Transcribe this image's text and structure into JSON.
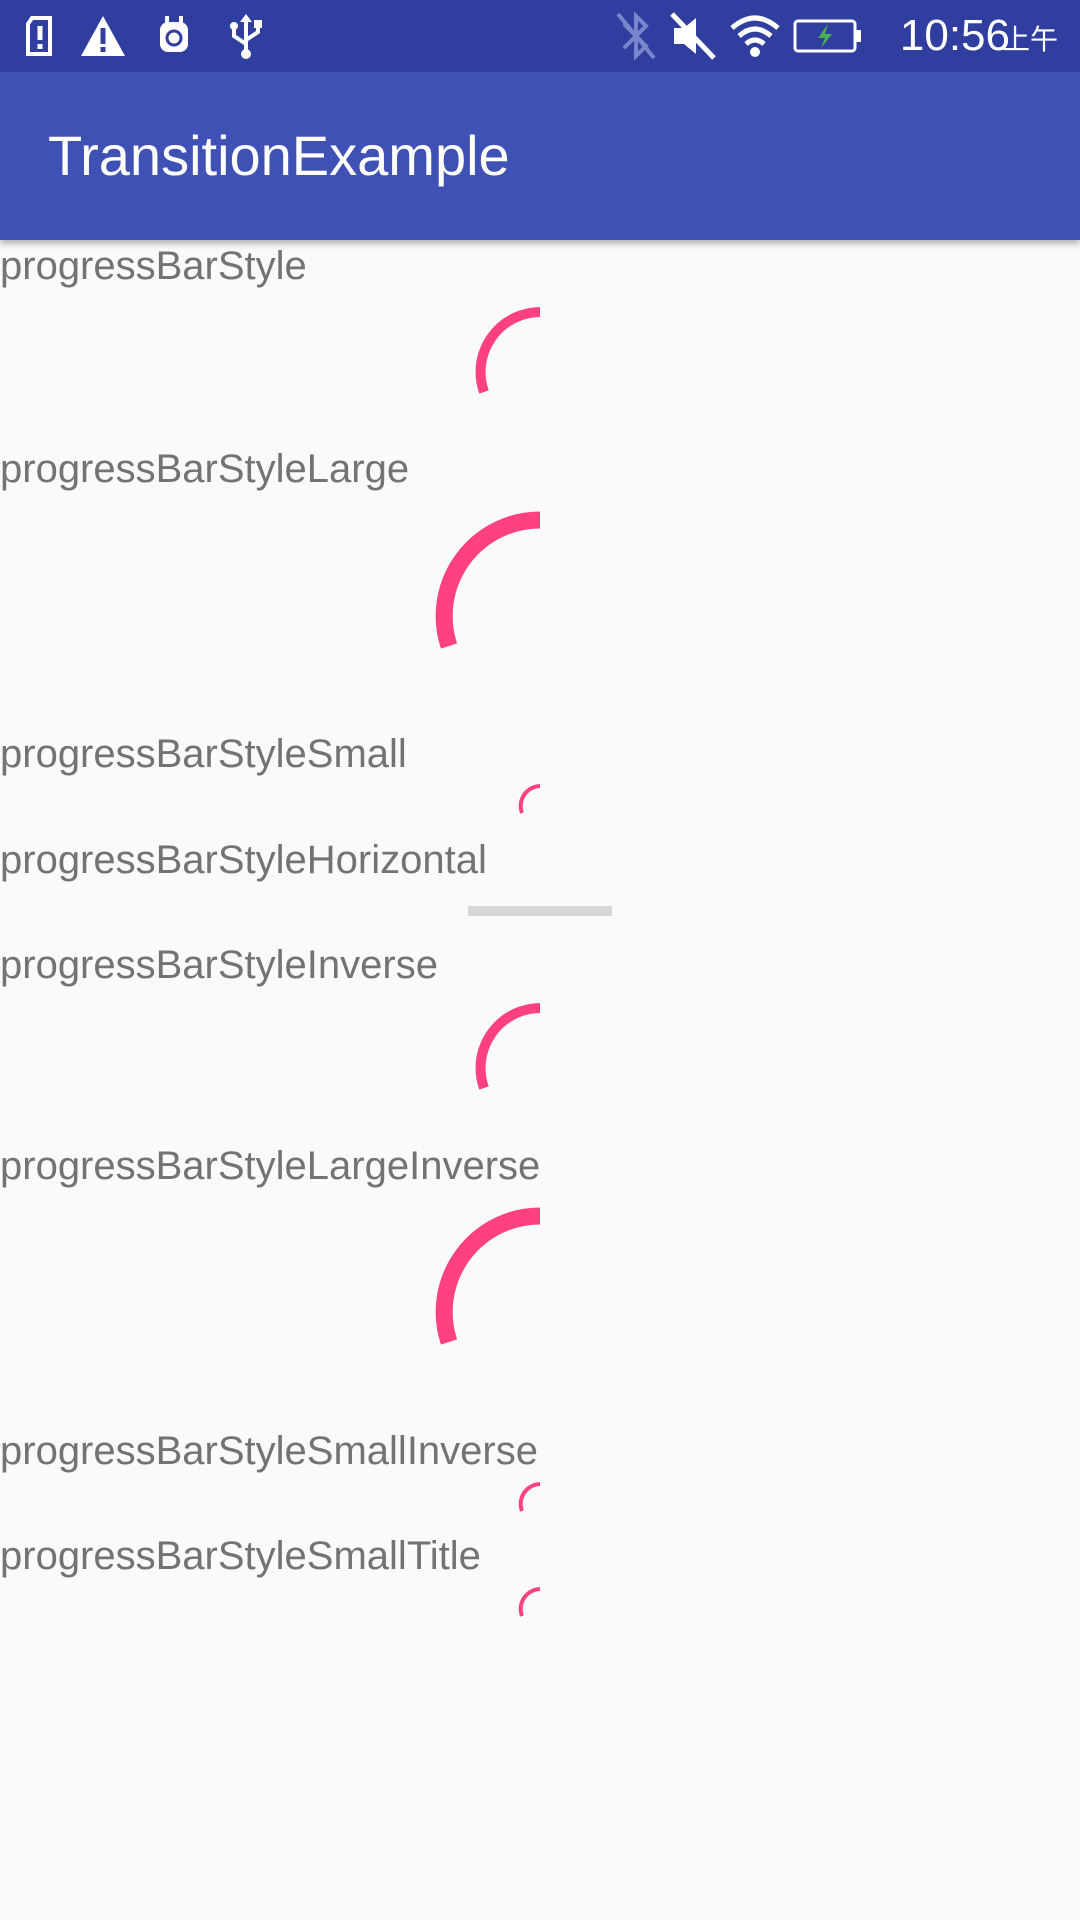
{
  "status_bar": {
    "time": "10:56",
    "ampm": "上午",
    "icons": [
      "sim-alert-icon",
      "warning-icon",
      "bug-icon",
      "usb-icon",
      "bluetooth-icon",
      "mute-icon",
      "wifi-icon",
      "battery-charging-icon"
    ]
  },
  "app_bar": {
    "title": "TransitionExample"
  },
  "progress_items": [
    {
      "label": "progressBarStyle",
      "type": "spinner-medium"
    },
    {
      "label": "progressBarStyleLarge",
      "type": "spinner-large"
    },
    {
      "label": "progressBarStyleSmall",
      "type": "spinner-small"
    },
    {
      "label": "progressBarStyleHorizontal",
      "type": "horizontal"
    },
    {
      "label": "progressBarStyleInverse",
      "type": "spinner-medium"
    },
    {
      "label": "progressBarStyleLargeInverse",
      "type": "spinner-large"
    },
    {
      "label": "progressBarStyleSmallInverse",
      "type": "spinner-small"
    },
    {
      "label": "progressBarStyleSmallTitle",
      "type": "spinner-small"
    }
  ],
  "colors": {
    "status_bar": "#303f9f",
    "app_bar": "#3f51b5",
    "accent": "#ff4081",
    "label_text": "#737373",
    "track": "#d6d6d6",
    "background": "#fafafa"
  }
}
